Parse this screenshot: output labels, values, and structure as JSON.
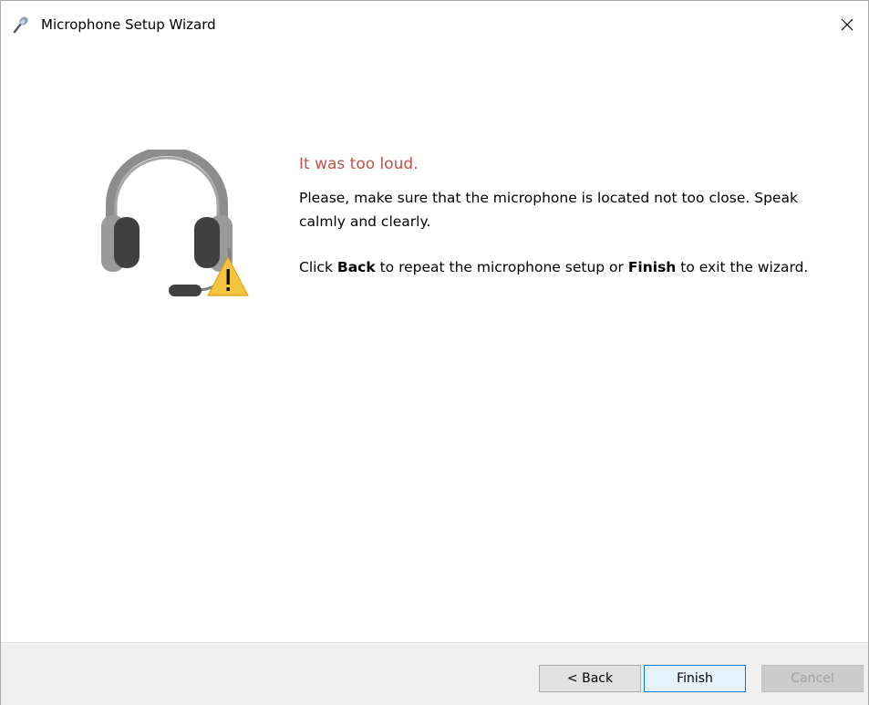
{
  "window": {
    "title": "Microphone Setup Wizard"
  },
  "message": {
    "heading": "It was too loud.",
    "paragraph1": "Please, make sure that the microphone is located not too close. Speak calmly and clearly.",
    "paragraph2_prefix": "Click ",
    "paragraph2_back": "Back",
    "paragraph2_middle": " to repeat the microphone setup or ",
    "paragraph2_finish": "Finish",
    "paragraph2_suffix": " to exit the wizard."
  },
  "buttons": {
    "back": "< Back",
    "finish": "Finish",
    "cancel": "Cancel"
  },
  "icons": {
    "app": "microphone-icon",
    "close": "close-icon",
    "illustration": "headset-icon",
    "warning": "warning-icon"
  },
  "colors": {
    "heading": "#c0504d",
    "warning": "#f5c53d",
    "headset": "#7f7f7f",
    "finish_border": "#0078d7"
  }
}
